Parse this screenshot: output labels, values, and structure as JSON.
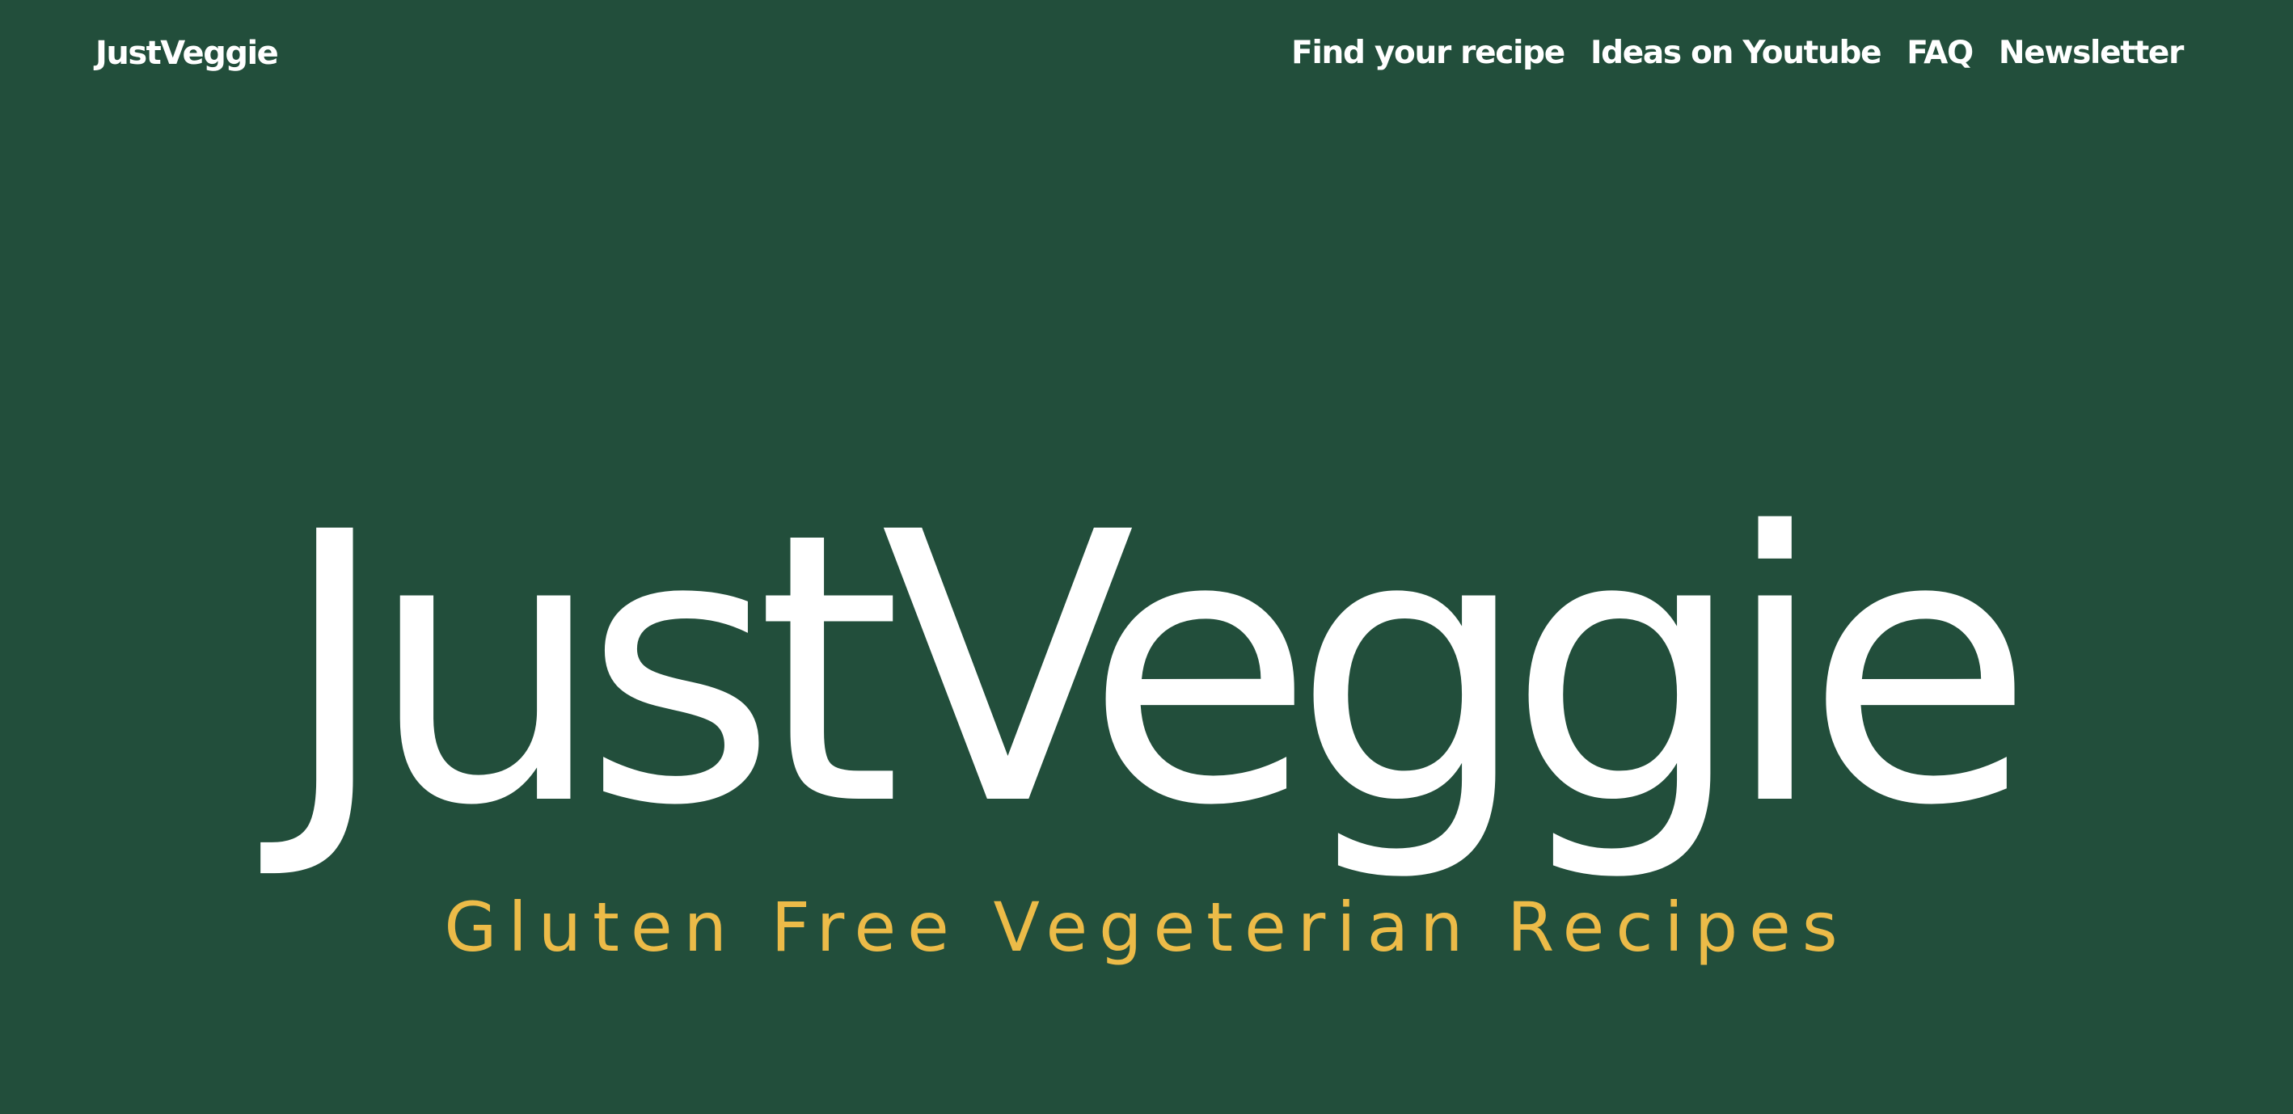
{
  "header": {
    "brand": "JustVeggie",
    "nav": {
      "find_recipe": "Find your recipe",
      "youtube": "Ideas on Youtube",
      "faq": "FAQ",
      "newsletter": "Newsletter"
    }
  },
  "hero": {
    "title": "JustVeggie",
    "subtitle": "Gluten Free Vegeterian Recipes"
  },
  "colors": {
    "background": "#224e3b",
    "text": "#ffffff",
    "accent": "#ecbb48"
  }
}
